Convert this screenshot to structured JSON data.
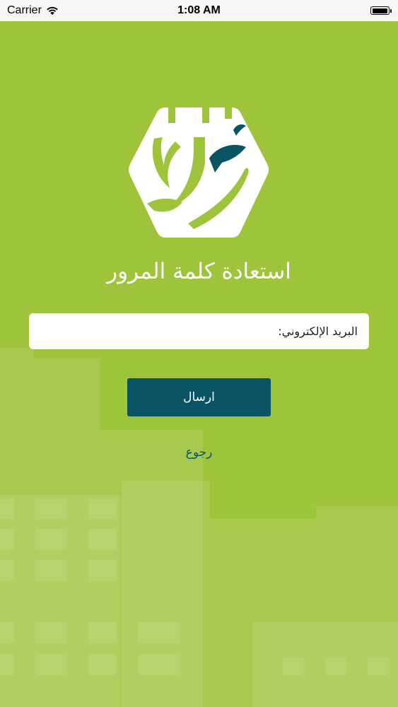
{
  "status_bar": {
    "carrier": "Carrier",
    "time": "1:08 AM"
  },
  "logo": {
    "name": "brand-logo"
  },
  "title": "استعادة كلمة المرور",
  "email": {
    "placeholder": "البريد الإلكتروني:",
    "value": ""
  },
  "send_button": "ارسال",
  "back_link": "رجوع",
  "colors": {
    "background": "#9dc43a",
    "accent": "#0a5565",
    "white": "#ffffff"
  }
}
